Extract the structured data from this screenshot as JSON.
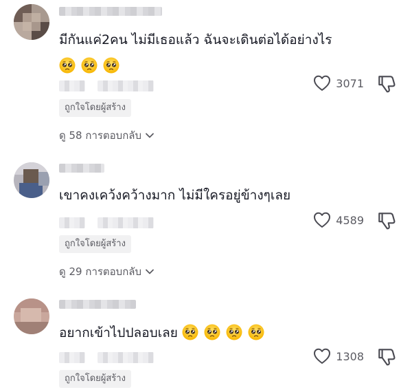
{
  "comments": [
    {
      "text": "มีกันแค่2คน ไม่มีเธอแล้ว ฉันจะเดินต่อได้อย่างไร",
      "emoji_line": [
        "pleading-face-emoji",
        "pleading-face-emoji",
        "pleading-face-emoji"
      ],
      "likes": "3071",
      "liked_by_creator": "ถูกใจโดยผู้สร้าง",
      "replies": "ดู 58 การตอบกลับ"
    },
    {
      "text": "เขาคงเคว้งคว้างมาก ไม่มีใครอยู่ข้างๆเลย",
      "likes": "4589",
      "liked_by_creator": "ถูกใจโดยผู้สร้าง",
      "replies": "ดู 29 การตอบกลับ"
    },
    {
      "text": "อยากเข้าไปปลอบเลย",
      "inline_emojis": [
        "pleading-face-emoji",
        "pleading-face-emoji",
        "pleading-face-emoji",
        "pleading-face-emoji"
      ],
      "likes": "1308",
      "liked_by_creator": "ถูกใจโดยผู้สร้าง"
    }
  ],
  "icons": {
    "like": "heart-outline-icon",
    "dislike": "thumbs-down-outline-icon",
    "expand": "chevron-down-icon"
  },
  "colors": {
    "text": "#161823",
    "secondary": "#5b5b62",
    "badge_bg": "#f1f1f2"
  }
}
